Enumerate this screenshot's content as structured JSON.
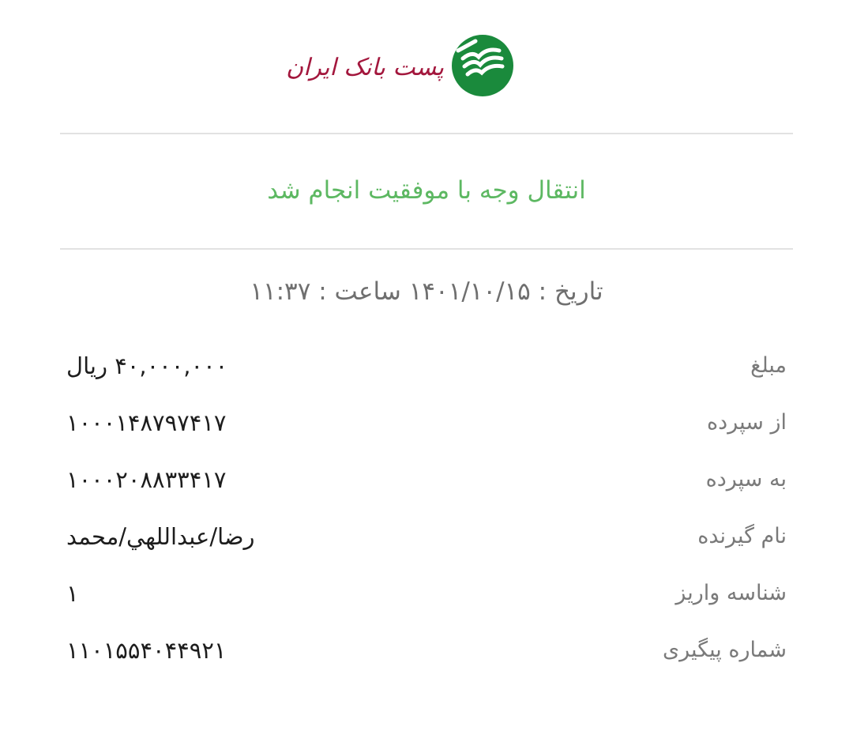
{
  "bank": {
    "name": "پست بانک ایران",
    "emblem_icon": "post-bank-emblem-icon",
    "emblem_color": "#1a8a3c",
    "name_color": "#a3173d"
  },
  "status": {
    "message": "انتقال وجه با موفقیت انجام شد",
    "color": "#5db862"
  },
  "datetime": {
    "text": "تاریخ : ۱۴۰۱/۱۰/۱۵ ساعت : ۱۱:۳۷"
  },
  "details": [
    {
      "label": "مبلغ",
      "value": "۴۰,۰۰۰,۰۰۰ ریال"
    },
    {
      "label": "از سپرده",
      "value": "۱۰۰۰۱۴۸۷۹۷۴۱۷"
    },
    {
      "label": "به سپرده",
      "value": "۱۰۰۰۲۰۸۸۳۳۴۱۷"
    },
    {
      "label": "نام گیرنده",
      "value": "رضا/عبداللهي/محمد"
    },
    {
      "label": "شناسه واریز",
      "value": "۱"
    },
    {
      "label": "شماره پیگیری",
      "value": "۱۱۰۱۵۵۴۰۴۴۹۲۱"
    }
  ]
}
